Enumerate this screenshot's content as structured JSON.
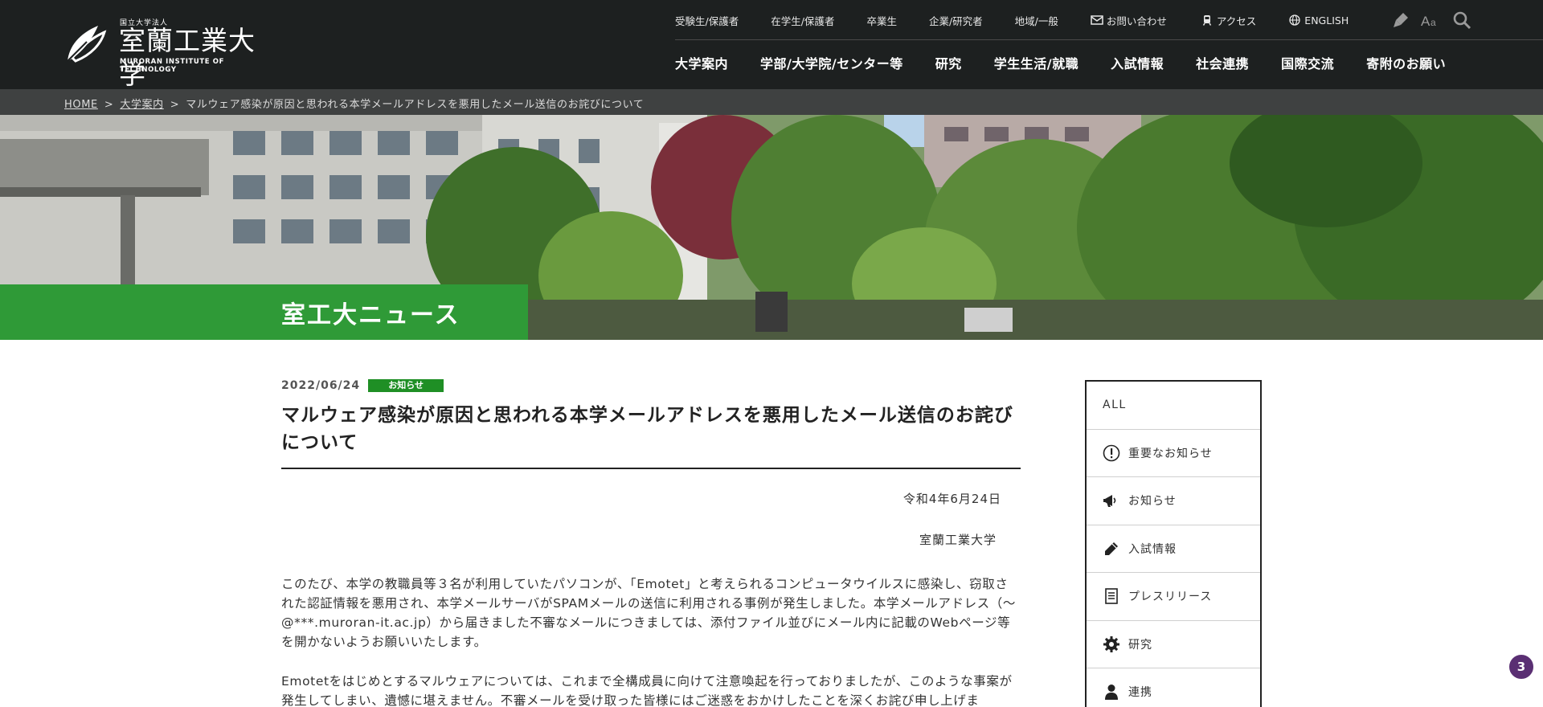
{
  "header": {
    "logo": {
      "small": "国立大学法人",
      "name": "室蘭工業大学",
      "english": "MURORAN INSTITUTE OF TECHNOLOGY"
    },
    "top_links": [
      "受験生/保護者",
      "在学生/保護者",
      "卒業生",
      "企業/研究者",
      "地域/一般"
    ],
    "utility": {
      "contact": "お問い合わせ",
      "access": "アクセス",
      "english": "ENGLISH"
    },
    "main_nav": [
      "大学案内",
      "学部/大学院/センター等",
      "研究",
      "学生生活/就職",
      "入試情報",
      "社会連携",
      "国際交流",
      "寄附のお願い"
    ]
  },
  "breadcrumb": {
    "home": "HOME",
    "parent": "大学案内",
    "current": "マルウェア感染が原因と思われる本学メールアドレスを悪用したメール送信のお詫びについて"
  },
  "hero": {
    "title": "室工大ニュース"
  },
  "article": {
    "date": "2022/06/24",
    "badge": "お知らせ",
    "title": "マルウェア感染が原因と思われる本学メールアドレスを悪用したメール送信のお詫びについて",
    "issue_date": "令和4年6月24日",
    "issuer": "室蘭工業大学",
    "paragraph1": "このたび、本学の教職員等３名が利用していたパソコンが、「Emotet」と考えられるコンピュータウイルスに感染し、窃取された認証情報を悪用され、本学メールサーバがSPAMメールの送信に利用される事例が発生しました。本学メールアドレス（～@***.muroran-it.ac.jp）から届きました不審なメールにつきましては、添付ファイル並びにメール内に記載のWebページ等を開かないようお願いいたします。",
    "paragraph2": "Emotetをはじめとするマルウェアについては、これまで全構成員に向けて注意喚起を行っておりましたが、このような事案が発生してしまい、遺憾に堪えません。不審メールを受け取った皆様にはご迷惑をおかけしたことを深くお詫び申し上げま"
  },
  "sidebar": {
    "categories": [
      "ALL",
      "重要なお知らせ",
      "お知らせ",
      "入試情報",
      "プレスリリース",
      "研究",
      "連携"
    ]
  },
  "float_badge": "3",
  "colors": {
    "header_bg": "#1d2020",
    "breadcrumb_bg": "#3f4141",
    "accent_green": "#2f9a37",
    "badge_green": "#1f8f25",
    "float_badge": "#5a2f73"
  }
}
